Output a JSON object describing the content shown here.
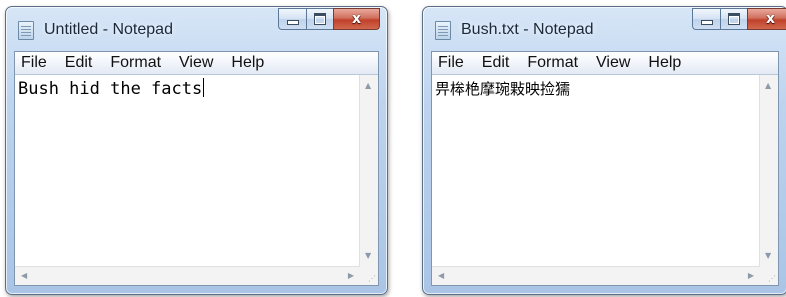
{
  "windows": [
    {
      "title": "Untitled - Notepad",
      "menu": [
        "File",
        "Edit",
        "Format",
        "View",
        "Help"
      ],
      "text": "Bush hid the facts",
      "close_glyph": "x"
    },
    {
      "title": "Bush.txt - Notepad",
      "menu": [
        "File",
        "Edit",
        "Format",
        "View",
        "Help"
      ],
      "text": "畀桳栬摩琬敤映捡獳",
      "close_glyph": "x"
    }
  ],
  "icons": {
    "app": "notepad-icon",
    "minimize": "minimize-icon",
    "maximize": "maximize-icon",
    "close": "close-icon"
  },
  "colors": {
    "frame": "#bdd3ee",
    "close_button": "#c0412a",
    "menubar": "#f1f5fb"
  }
}
